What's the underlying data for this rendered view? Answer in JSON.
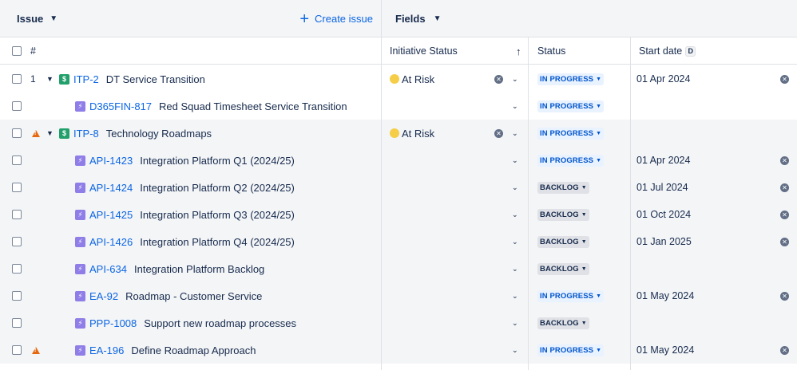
{
  "toolbar": {
    "issue_label": "Issue",
    "create_label": "Create issue",
    "fields_label": "Fields"
  },
  "headers": {
    "num": "#",
    "initiative_status": "Initiative Status",
    "status": "Status",
    "start_date": "Start date",
    "start_date_badge": "D"
  },
  "rows": [
    {
      "num": "1",
      "key": "ITP-2",
      "summary": "DT Service Transition",
      "type": "initiative",
      "expand": true,
      "warn": false,
      "initiative_status": "At Risk",
      "status": "IN PROGRESS",
      "status_color": "blue",
      "start_date": "01 Apr 2024",
      "shade": false
    },
    {
      "num": "",
      "key": "D365FIN-817",
      "summary": "Red Squad Timesheet Service Transition",
      "type": "epic",
      "expand": false,
      "warn": false,
      "initiative_status": "",
      "status": "IN PROGRESS",
      "status_color": "blue",
      "start_date": "",
      "shade": false
    },
    {
      "num": "",
      "key": "ITP-8",
      "summary": "Technology Roadmaps",
      "type": "initiative",
      "expand": true,
      "warn": true,
      "initiative_status": "At Risk",
      "status": "IN PROGRESS",
      "status_color": "blue",
      "start_date": "",
      "shade": true
    },
    {
      "num": "",
      "key": "API-1423",
      "summary": "Integration Platform Q1 (2024/25)",
      "type": "epic",
      "expand": false,
      "warn": false,
      "initiative_status": "",
      "status": "IN PROGRESS",
      "status_color": "blue",
      "start_date": "01 Apr 2024",
      "shade": true
    },
    {
      "num": "",
      "key": "API-1424",
      "summary": "Integration Platform Q2 (2024/25)",
      "type": "epic",
      "expand": false,
      "warn": false,
      "initiative_status": "",
      "status": "BACKLOG",
      "status_color": "gray",
      "start_date": "01 Jul 2024",
      "shade": true
    },
    {
      "num": "",
      "key": "API-1425",
      "summary": "Integration Platform Q3 (2024/25)",
      "type": "epic",
      "expand": false,
      "warn": false,
      "initiative_status": "",
      "status": "BACKLOG",
      "status_color": "gray",
      "start_date": "01 Oct 2024",
      "shade": true
    },
    {
      "num": "",
      "key": "API-1426",
      "summary": "Integration Platform Q4 (2024/25)",
      "type": "epic",
      "expand": false,
      "warn": false,
      "initiative_status": "",
      "status": "BACKLOG",
      "status_color": "gray",
      "start_date": "01 Jan 2025",
      "shade": true
    },
    {
      "num": "",
      "key": "API-634",
      "summary": "Integration Platform Backlog",
      "type": "epic",
      "expand": false,
      "warn": false,
      "initiative_status": "",
      "status": "BACKLOG",
      "status_color": "gray",
      "start_date": "",
      "shade": true
    },
    {
      "num": "",
      "key": "EA-92",
      "summary": "Roadmap - Customer Service",
      "type": "epic",
      "expand": false,
      "warn": false,
      "initiative_status": "",
      "status": "IN PROGRESS",
      "status_color": "blue",
      "start_date": "01 May 2024",
      "shade": true
    },
    {
      "num": "",
      "key": "PPP-1008",
      "summary": "Support new roadmap processes",
      "type": "epic",
      "expand": false,
      "warn": false,
      "initiative_status": "",
      "status": "BACKLOG",
      "status_color": "gray",
      "start_date": "",
      "shade": true
    },
    {
      "num": "",
      "key": "EA-196",
      "summary": "Define Roadmap Approach",
      "type": "epic",
      "expand": false,
      "warn": true,
      "initiative_status": "",
      "status": "IN PROGRESS",
      "status_color": "blue",
      "start_date": "01 May 2024",
      "shade": true
    }
  ]
}
